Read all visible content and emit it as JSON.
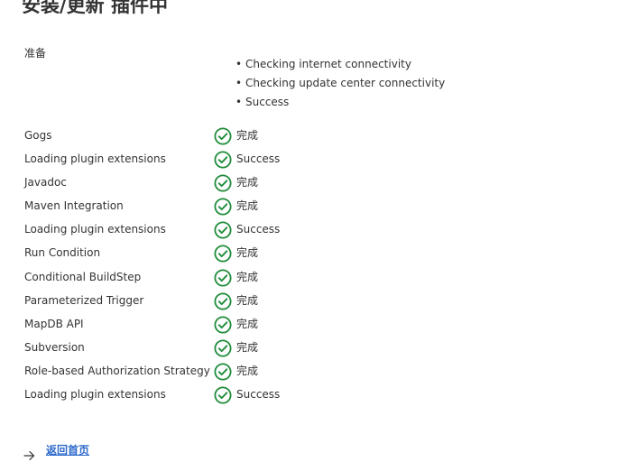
{
  "page": {
    "title": "安装/更新 插件中",
    "back_link": "返回首页"
  },
  "preparation": {
    "label": "准备",
    "items": [
      "Checking internet connectivity",
      "Checking update center connectivity",
      "Success"
    ]
  },
  "plugins": [
    {
      "name": "Gogs",
      "status": "完成"
    },
    {
      "name": "Loading plugin extensions",
      "status": "Success"
    },
    {
      "name": "Javadoc",
      "status": "完成"
    },
    {
      "name": "Maven Integration",
      "status": "完成"
    },
    {
      "name": "Loading plugin extensions",
      "status": "Success"
    },
    {
      "name": "Run Condition",
      "status": "完成"
    },
    {
      "name": "Conditional BuildStep",
      "status": "完成"
    },
    {
      "name": "Parameterized Trigger",
      "status": "完成"
    },
    {
      "name": "MapDB API",
      "status": "完成"
    },
    {
      "name": "Subversion",
      "status": "完成"
    },
    {
      "name": "Role-based Authorization Strategy",
      "status": "完成"
    },
    {
      "name": "Loading plugin extensions",
      "status": "Success"
    }
  ],
  "icons": {
    "status": "check-circle-icon",
    "back": "arrow-right-icon"
  },
  "colors": {
    "success": "#1f8c3a",
    "link": "#2d6acb",
    "text": "#333333"
  }
}
